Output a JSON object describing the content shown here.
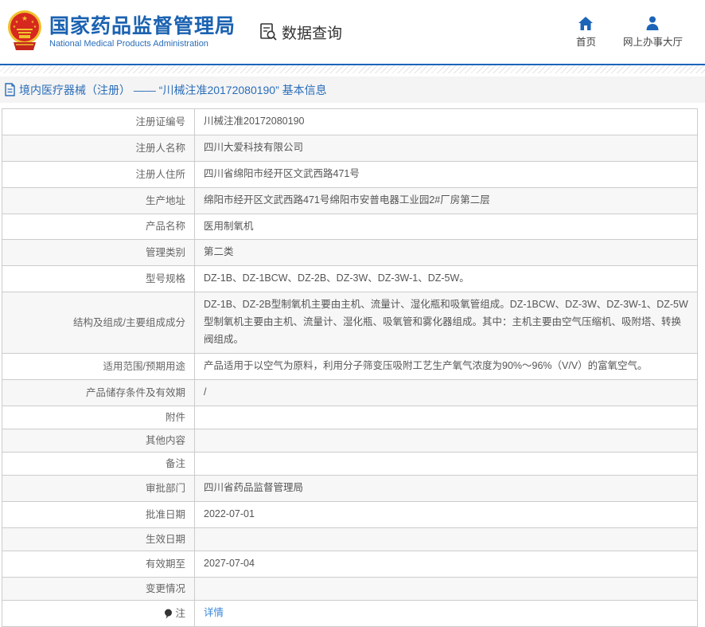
{
  "header": {
    "org_name_cn": "国家药品监督管理局",
    "org_name_en": "National Medical Products Administration",
    "data_query_label": "数据查询",
    "nav": [
      {
        "label": "首页",
        "icon": "home-icon"
      },
      {
        "label": "网上办事大厅",
        "icon": "person-icon"
      }
    ]
  },
  "breadcrumb": {
    "icon": "document-icon",
    "text": "境内医疗器械（注册） —— “川械注准20172080190” 基本信息"
  },
  "table": {
    "rows": [
      {
        "label": "注册证编号",
        "value": "川械注准20172080190"
      },
      {
        "label": "注册人名称",
        "value": "四川大爱科技有限公司"
      },
      {
        "label": "注册人住所",
        "value": "四川省绵阳市经开区文武西路471号"
      },
      {
        "label": "生产地址",
        "value": "绵阳市经开区文武西路471号绵阳市安普电器工业园2#厂房第二层"
      },
      {
        "label": "产品名称",
        "value": "医用制氧机"
      },
      {
        "label": "管理类别",
        "value": "第二类"
      },
      {
        "label": "型号规格",
        "value": "DZ-1B、DZ-1BCW、DZ-2B、DZ-3W、DZ-3W-1、DZ-5W。"
      },
      {
        "label": "结构及组成/主要组成成分",
        "value": "DZ-1B、DZ-2B型制氧机主要由主机、流量计、湿化瓶和吸氧管组成。DZ-1BCW、DZ-3W、DZ-3W-1、DZ-5W型制氧机主要由主机、流量计、湿化瓶、吸氧管和雾化器组成。其中：主机主要由空气压缩机、吸附塔、转换阀组成。"
      },
      {
        "label": "适用范围/预期用途",
        "value": "产品适用于以空气为原料，利用分子筛变压吸附工艺生产氧气浓度为90%～96%（V/V）的富氧空气。"
      },
      {
        "label": "产品储存条件及有效期",
        "value": "/"
      },
      {
        "label": "附件",
        "value": ""
      },
      {
        "label": "其他内容",
        "value": ""
      },
      {
        "label": "备注",
        "value": ""
      },
      {
        "label": "审批部门",
        "value": "四川省药品监督管理局"
      },
      {
        "label": "批准日期",
        "value": "2022-07-01"
      },
      {
        "label": "生效日期",
        "value": ""
      },
      {
        "label": "有效期至",
        "value": "2027-07-04"
      },
      {
        "label": "变更情况",
        "value": ""
      },
      {
        "label": "注",
        "value": "详情",
        "icon": "note-icon"
      }
    ]
  },
  "icons": {
    "logo": "national-emblem",
    "data_query": "doc-search-icon",
    "home": "home-icon",
    "person": "person-icon",
    "breadcrumb": "document-icon",
    "note": "note-balloon-icon"
  },
  "colors": {
    "brand_blue": "#1b62b1",
    "icon_blue": "#1c64b8",
    "breadcrumb_blue": "#2a6db9",
    "link_blue": "#3a86d8",
    "emblem_red": "#d6281e",
    "emblem_gold": "#f0c02c",
    "row_alt_gray": "#f7f7f7",
    "border_gray": "#cccccc"
  }
}
